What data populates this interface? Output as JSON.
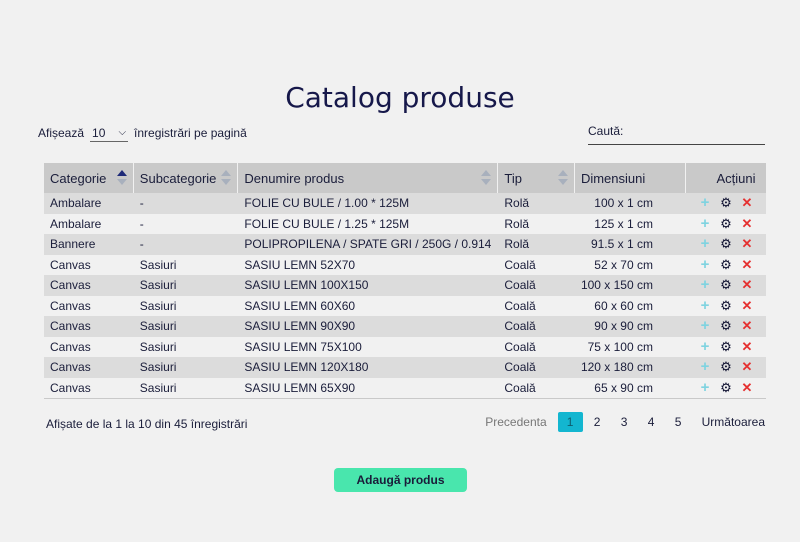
{
  "page": {
    "title": "Catalog produse"
  },
  "controls": {
    "show_label": "Afișează",
    "page_size": "10",
    "per_page_label": "înregistrări pe pagină",
    "search_label": "Caută:",
    "search_value": ""
  },
  "table": {
    "headers": [
      "Categorie",
      "Subcategorie",
      "Denumire produs",
      "Tip",
      "Dimensiuni",
      "Acțiuni"
    ],
    "rows": [
      {
        "cat": "Ambalare",
        "sub": "-",
        "name": "FOLIE CU BULE / 1.00 * 125M",
        "tip": "Rolă",
        "dim": "100 x 1 cm"
      },
      {
        "cat": "Ambalare",
        "sub": "-",
        "name": "FOLIE CU BULE / 1.25 * 125M",
        "tip": "Rolă",
        "dim": "125 x 1 cm"
      },
      {
        "cat": "Bannere",
        "sub": "-",
        "name": "POLIPROPILENA / SPATE GRI / 250G / 0.914",
        "tip": "Rolă",
        "dim": "91.5 x 1 cm"
      },
      {
        "cat": "Canvas",
        "sub": "Sasiuri",
        "name": "SASIU LEMN 52X70",
        "tip": "Coală",
        "dim": "52 x 70 cm"
      },
      {
        "cat": "Canvas",
        "sub": "Sasiuri",
        "name": "SASIU LEMN 100X150",
        "tip": "Coală",
        "dim": "100 x 150 cm"
      },
      {
        "cat": "Canvas",
        "sub": "Sasiuri",
        "name": "SASIU LEMN 60X60",
        "tip": "Coală",
        "dim": "60 x 60 cm"
      },
      {
        "cat": "Canvas",
        "sub": "Sasiuri",
        "name": "SASIU LEMN 90X90",
        "tip": "Coală",
        "dim": "90 x 90 cm"
      },
      {
        "cat": "Canvas",
        "sub": "Sasiuri",
        "name": "SASIU LEMN 75X100",
        "tip": "Coală",
        "dim": "75 x 100 cm"
      },
      {
        "cat": "Canvas",
        "sub": "Sasiuri",
        "name": "SASIU LEMN 120X180",
        "tip": "Coală",
        "dim": "120 x 180 cm"
      },
      {
        "cat": "Canvas",
        "sub": "Sasiuri",
        "name": "SASIU LEMN 65X90",
        "tip": "Coală",
        "dim": "65 x 90 cm"
      }
    ],
    "row_actions": [
      "plus-icon",
      "gear-icon",
      "close-icon"
    ]
  },
  "footer": {
    "info": "Afișate de la 1 la 10 din 45 înregistrări",
    "prev": "Precedenta",
    "pages": [
      "1",
      "2",
      "3",
      "4",
      "5"
    ],
    "active_page": "1",
    "next": "Următoarea"
  },
  "actions": {
    "add_product": "Adaugă produs"
  },
  "colors": {
    "accent_button": "#49e6ad",
    "active_page": "#13b6d0",
    "delete_icon": "#e53030",
    "add_icon": "#7fd3e0",
    "header_bg": "#c9c9c9"
  }
}
